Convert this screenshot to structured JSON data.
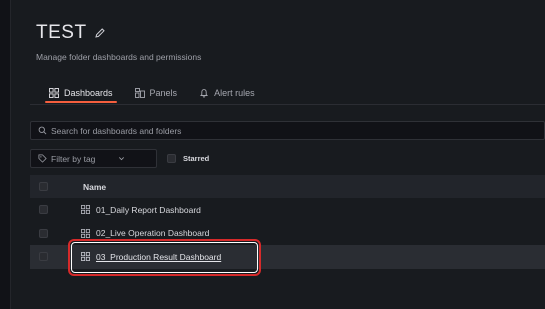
{
  "folder": {
    "title": "TEST",
    "subtitle": "Manage folder dashboards and permissions"
  },
  "tabs": [
    {
      "label": "Dashboards",
      "active": true,
      "icon": "apps-icon"
    },
    {
      "label": "Panels",
      "active": false,
      "icon": "panels-icon"
    },
    {
      "label": "Alert rules",
      "active": false,
      "icon": "bell-icon"
    }
  ],
  "search": {
    "placeholder": "Search for dashboards and folders",
    "value": ""
  },
  "filter": {
    "placeholder": "Filter by tag",
    "starred_label": "Starred"
  },
  "table": {
    "header": "Name",
    "rows": [
      {
        "name": "01_Daily Report Dashboard"
      },
      {
        "name": "02_Live Operation Dashboard"
      },
      {
        "name": "03_Production Result Dashboard",
        "hovered": true
      }
    ]
  },
  "colors": {
    "accent_tab": "#f55f3e",
    "highlight_box": "#d62a2a",
    "background": "#181b1f"
  }
}
